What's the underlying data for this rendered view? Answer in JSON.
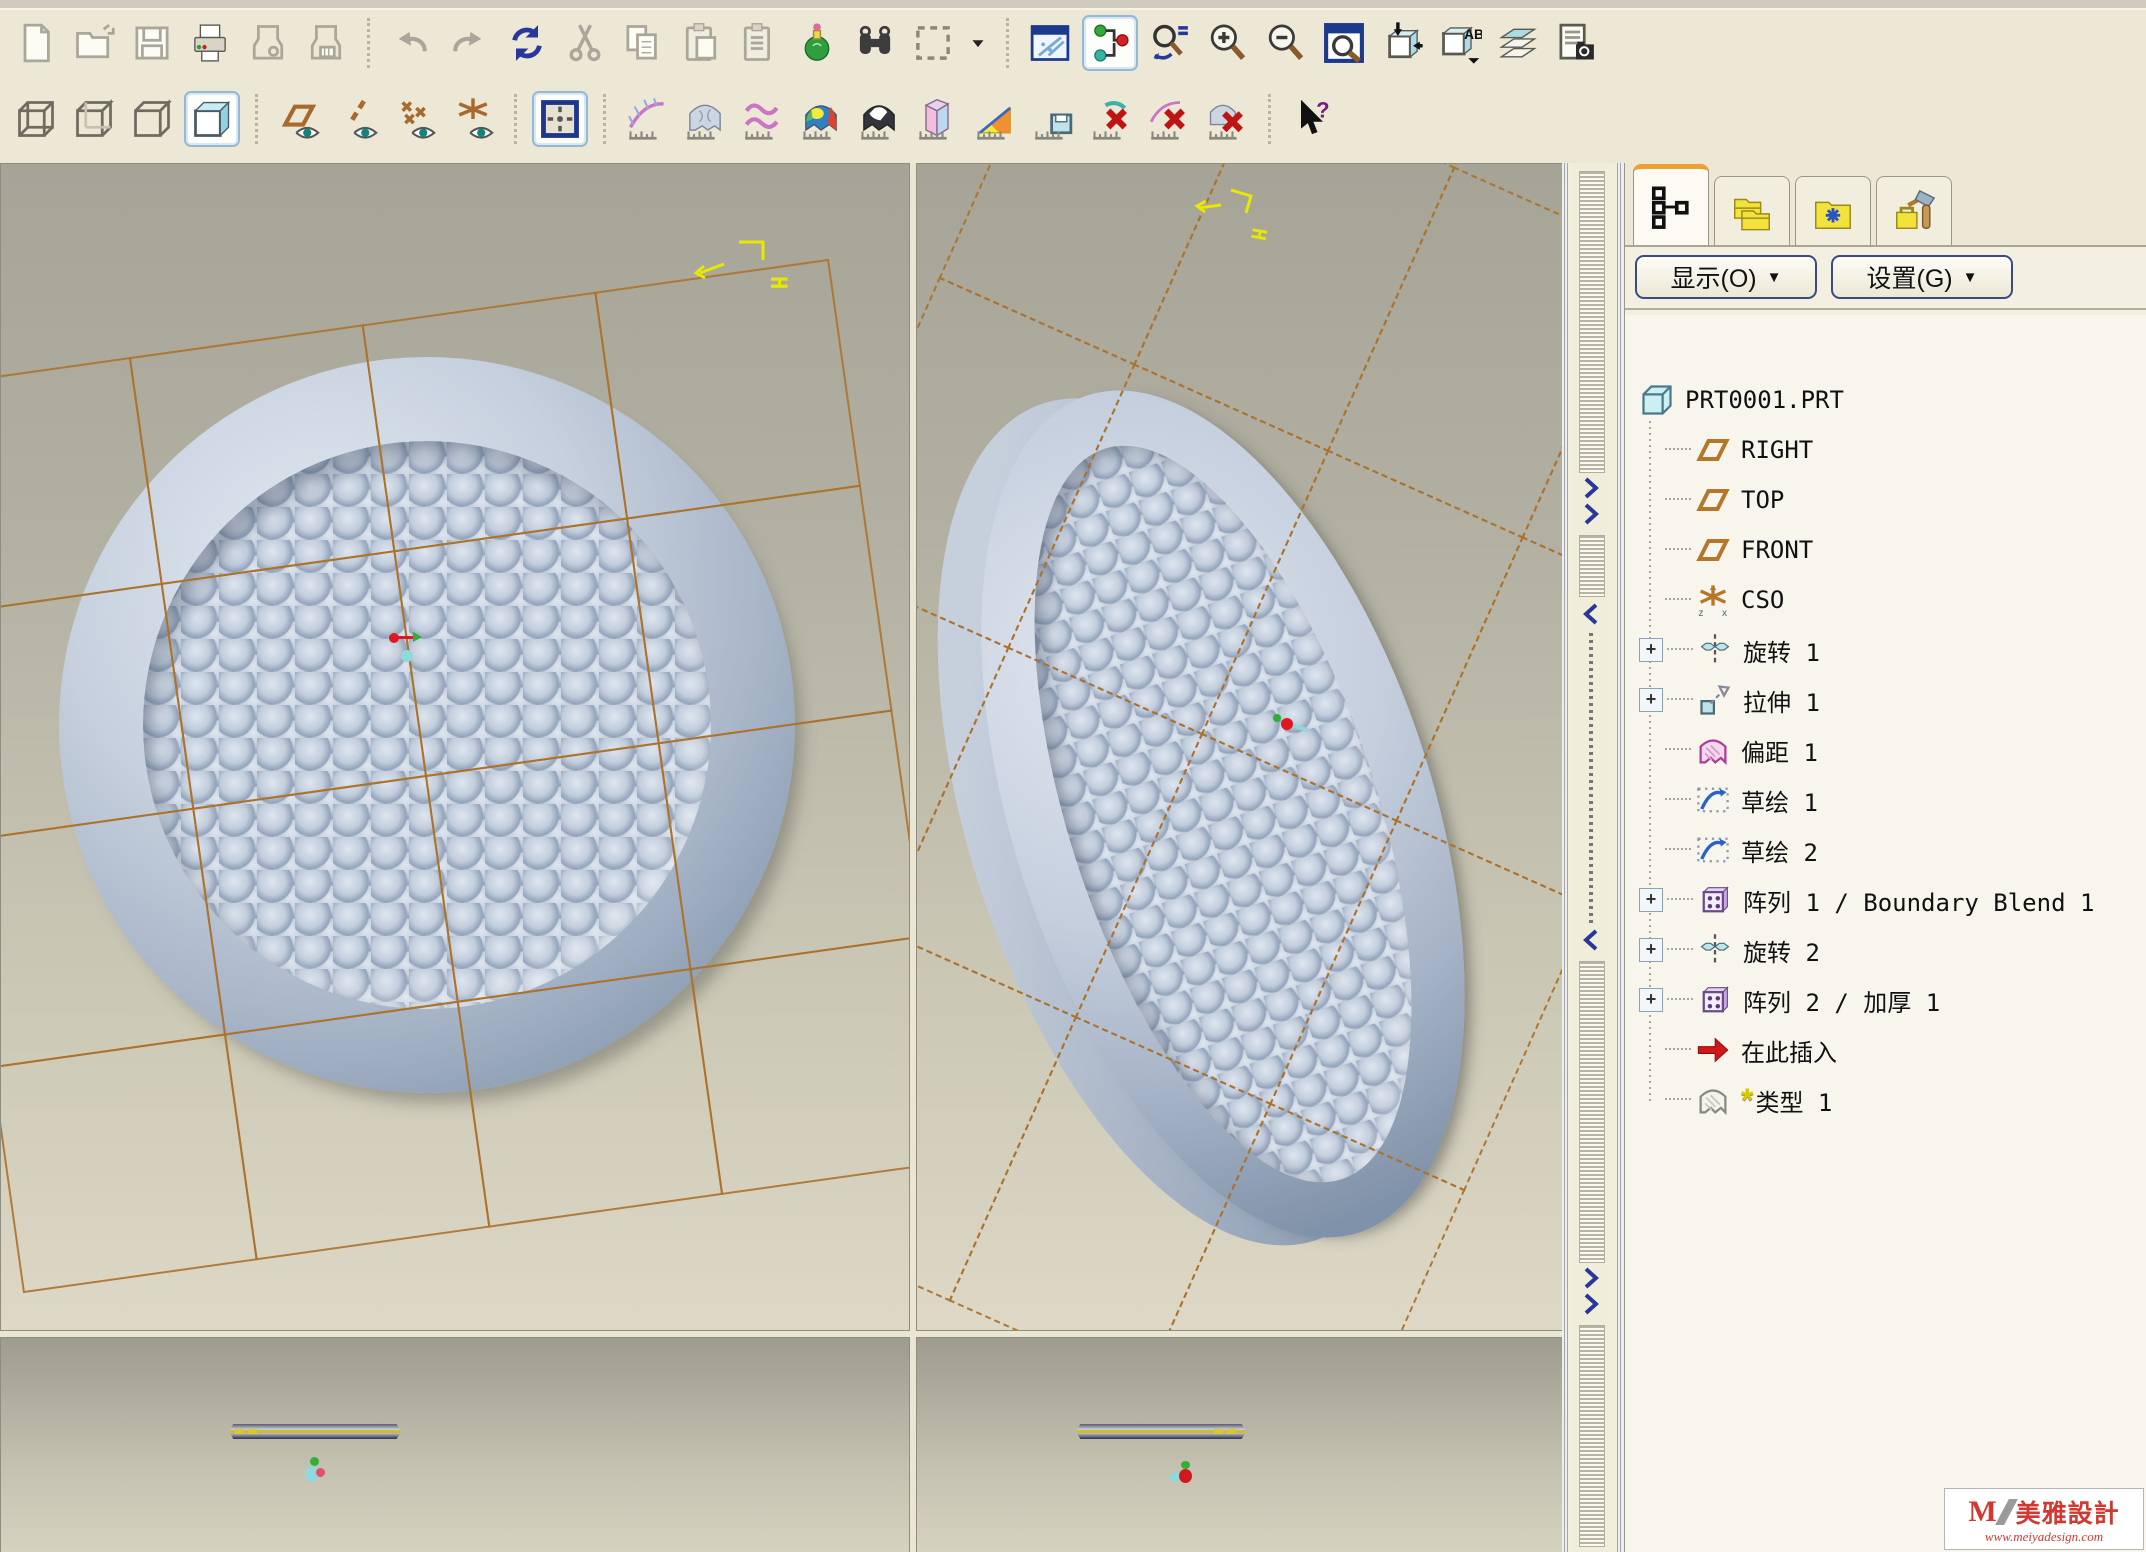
{
  "toolbar": {
    "row1": [
      {
        "name": "new-file-button",
        "icon": "new-file"
      },
      {
        "name": "open-file-button",
        "icon": "open-file"
      },
      {
        "name": "save-file-button",
        "icon": "save-file"
      },
      {
        "name": "print-button",
        "icon": "print"
      },
      {
        "name": "save-a-copy-button",
        "icon": "save-a-copy"
      },
      {
        "name": "backup-button",
        "icon": "backup"
      },
      {
        "sep": true
      },
      {
        "name": "undo-button",
        "icon": "undo"
      },
      {
        "name": "redo-button",
        "icon": "redo"
      },
      {
        "name": "regenerate-button",
        "icon": "regenerate"
      },
      {
        "name": "cut-button",
        "icon": "cut"
      },
      {
        "name": "copy-button",
        "icon": "copy"
      },
      {
        "name": "paste-button",
        "icon": "paste"
      },
      {
        "name": "paste-special-button",
        "icon": "paste-special"
      },
      {
        "name": "model-player-button",
        "icon": "model-player"
      },
      {
        "name": "find-button",
        "icon": "find"
      },
      {
        "name": "select-box-button",
        "icon": "select-box"
      },
      {
        "name": "select-mode-dropdown",
        "icon": "select-dropdown",
        "narrow": true
      },
      {
        "sep": true
      },
      {
        "name": "render-window-button",
        "icon": "render-window"
      },
      {
        "name": "model-tree-toggle-button",
        "icon": "model-tree-toggle",
        "selected": true
      },
      {
        "name": "search-options-button",
        "icon": "search-options"
      },
      {
        "name": "zoom-in-button",
        "icon": "zoom-in"
      },
      {
        "name": "zoom-out-button",
        "icon": "zoom-out"
      },
      {
        "name": "refit-button",
        "icon": "refit"
      },
      {
        "name": "reorient-button",
        "icon": "reorient"
      },
      {
        "name": "annotations-button",
        "icon": "annotations"
      },
      {
        "name": "layers-button",
        "icon": "layers"
      },
      {
        "name": "view-manager-button",
        "icon": "view-manager"
      }
    ],
    "row2": [
      {
        "name": "wireframe-button",
        "icon": "wireframe"
      },
      {
        "name": "hidden-line-button",
        "icon": "hidden-line"
      },
      {
        "name": "no-hidden-button",
        "icon": "no-hidden"
      },
      {
        "name": "shaded-button",
        "icon": "shaded",
        "selected": true
      },
      {
        "sep": true
      },
      {
        "name": "datum-planes-toggle",
        "icon": "datum-planes"
      },
      {
        "name": "datum-axes-toggle",
        "icon": "datum-axes"
      },
      {
        "name": "datum-points-toggle",
        "icon": "datum-points"
      },
      {
        "name": "datum-csys-toggle",
        "icon": "datum-csys"
      },
      {
        "sep": true
      },
      {
        "name": "spin-center-toggle",
        "icon": "spin-center",
        "selected": true
      },
      {
        "sep": true
      },
      {
        "name": "curvature-analysis-button",
        "icon": "curvature"
      },
      {
        "name": "surface-analysis-button",
        "icon": "surface-analysis"
      },
      {
        "name": "curves-analysis-button",
        "icon": "curves-analysis"
      },
      {
        "name": "shaded-curvature-button",
        "icon": "shaded-curvature"
      },
      {
        "name": "reflection-analysis-button",
        "icon": "reflection"
      },
      {
        "name": "section-analysis-button",
        "icon": "section"
      },
      {
        "name": "draft-check-button",
        "icon": "draft"
      },
      {
        "name": "saved-analyses-button",
        "icon": "saved-analyses"
      },
      {
        "name": "delete-all-analyses-button",
        "icon": "delete-analyses"
      },
      {
        "name": "delete-curvature-button",
        "icon": "delete-curvature"
      },
      {
        "name": "delete-surface-analysis-button",
        "icon": "delete-surface"
      },
      {
        "s0ep": false,
        "sep": true
      },
      {
        "name": "context-help-button",
        "icon": "context-help"
      }
    ]
  },
  "navigator": {
    "tabs": [
      {
        "name": "model-tree-tab",
        "icon": "tree-tab",
        "active": true
      },
      {
        "name": "folder-browser-tab",
        "icon": "folders-tab",
        "active": false
      },
      {
        "name": "favorites-tab",
        "icon": "favorites-tab",
        "active": false
      },
      {
        "name": "connections-tab",
        "icon": "connections-tab",
        "active": false
      }
    ],
    "show_button": {
      "label": "显示(O)",
      "arrow": "▼"
    },
    "settings_button": {
      "label": "设置(G)",
      "arrow": "▼"
    },
    "tree": [
      {
        "label": "PRT0001.PRT",
        "icon": "part",
        "level": 0
      },
      {
        "label": "RIGHT",
        "icon": "datum-plane",
        "level": 1
      },
      {
        "label": "TOP",
        "icon": "datum-plane",
        "level": 1
      },
      {
        "label": "FRONT",
        "icon": "datum-plane",
        "level": 1
      },
      {
        "label": "CSO",
        "icon": "csys",
        "level": 1
      },
      {
        "label": "旋转 1",
        "icon": "revolve",
        "level": 1,
        "expandable": true
      },
      {
        "label": "拉伸 1",
        "icon": "extrude",
        "level": 1,
        "expandable": true
      },
      {
        "label": "偏距 1",
        "icon": "offset",
        "level": 1
      },
      {
        "label": "草绘 1",
        "icon": "sketch",
        "level": 1
      },
      {
        "label": "草绘 2",
        "icon": "sketch",
        "level": 1
      },
      {
        "label": "阵列 1 / Boundary Blend 1",
        "icon": "pattern",
        "level": 1,
        "expandable": true
      },
      {
        "label": "旋转 2",
        "icon": "revolve",
        "level": 1,
        "expandable": true
      },
      {
        "label": "阵列 2 / 加厚 1",
        "icon": "pattern",
        "level": 1,
        "expandable": true
      },
      {
        "label": "在此插入",
        "icon": "insert-here",
        "level": 1
      },
      {
        "label": "类型 1",
        "icon": "style-surf",
        "level": 1,
        "prefix": "*"
      }
    ]
  },
  "viewports": {
    "tl": {
      "axis_label": "H"
    },
    "tr": {
      "axis_label": "H"
    }
  },
  "watermark": {
    "logo": "M",
    "title": "美雅設計",
    "url": "www.meiyadesign.com"
  }
}
